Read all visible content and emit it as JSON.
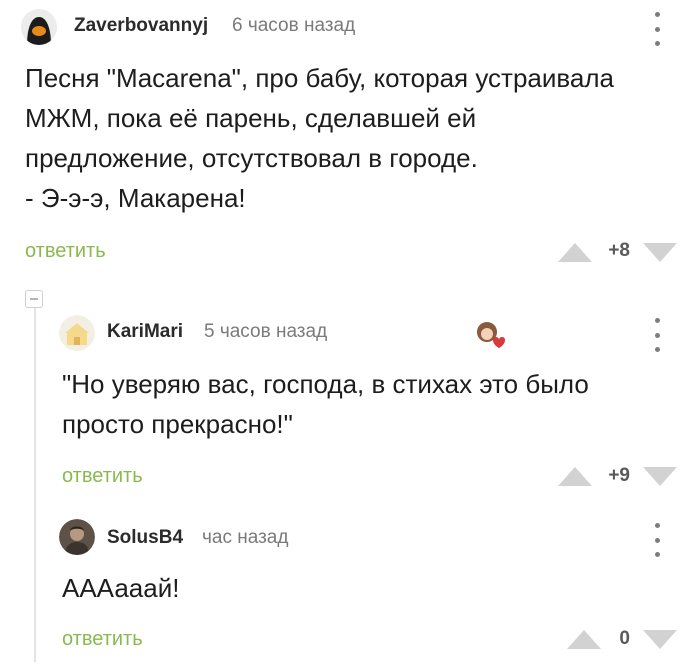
{
  "comments": [
    {
      "username": "Zaverbovannyj",
      "time": "6 часов назад",
      "text_lines": [
        "Песня \"Macarena\", про бабу, которая устраивала",
        "МЖМ, пока её парень, сделавшей ей",
        "предложение, отсутствовал в городе.",
        "- Э-э-э, Макарена!"
      ],
      "reply_label": "ответить",
      "score": "+8",
      "avatar_icon": "hooded-figure-avatar-icon"
    },
    {
      "username": "KariMari",
      "time": "5 часов назад",
      "text_lines": [
        "\"Но уверяю вас, господа, в стихах это было",
        "просто прекрасно!\""
      ],
      "reply_label": "ответить",
      "score": "+9",
      "avatar_icon": "cat-house-avatar-icon",
      "badge_icon": "girl-with-heart-badge-icon"
    },
    {
      "username": "SolusB4",
      "time": "час назад",
      "text_lines": [
        "АААааай!"
      ],
      "reply_label": "ответить",
      "score": "0",
      "avatar_icon": "person-photo-avatar-icon"
    }
  ],
  "colors": {
    "reply": "#8ab94f",
    "vote_arrow": "#d2d2d2",
    "thread_line": "#e4e4e4"
  }
}
